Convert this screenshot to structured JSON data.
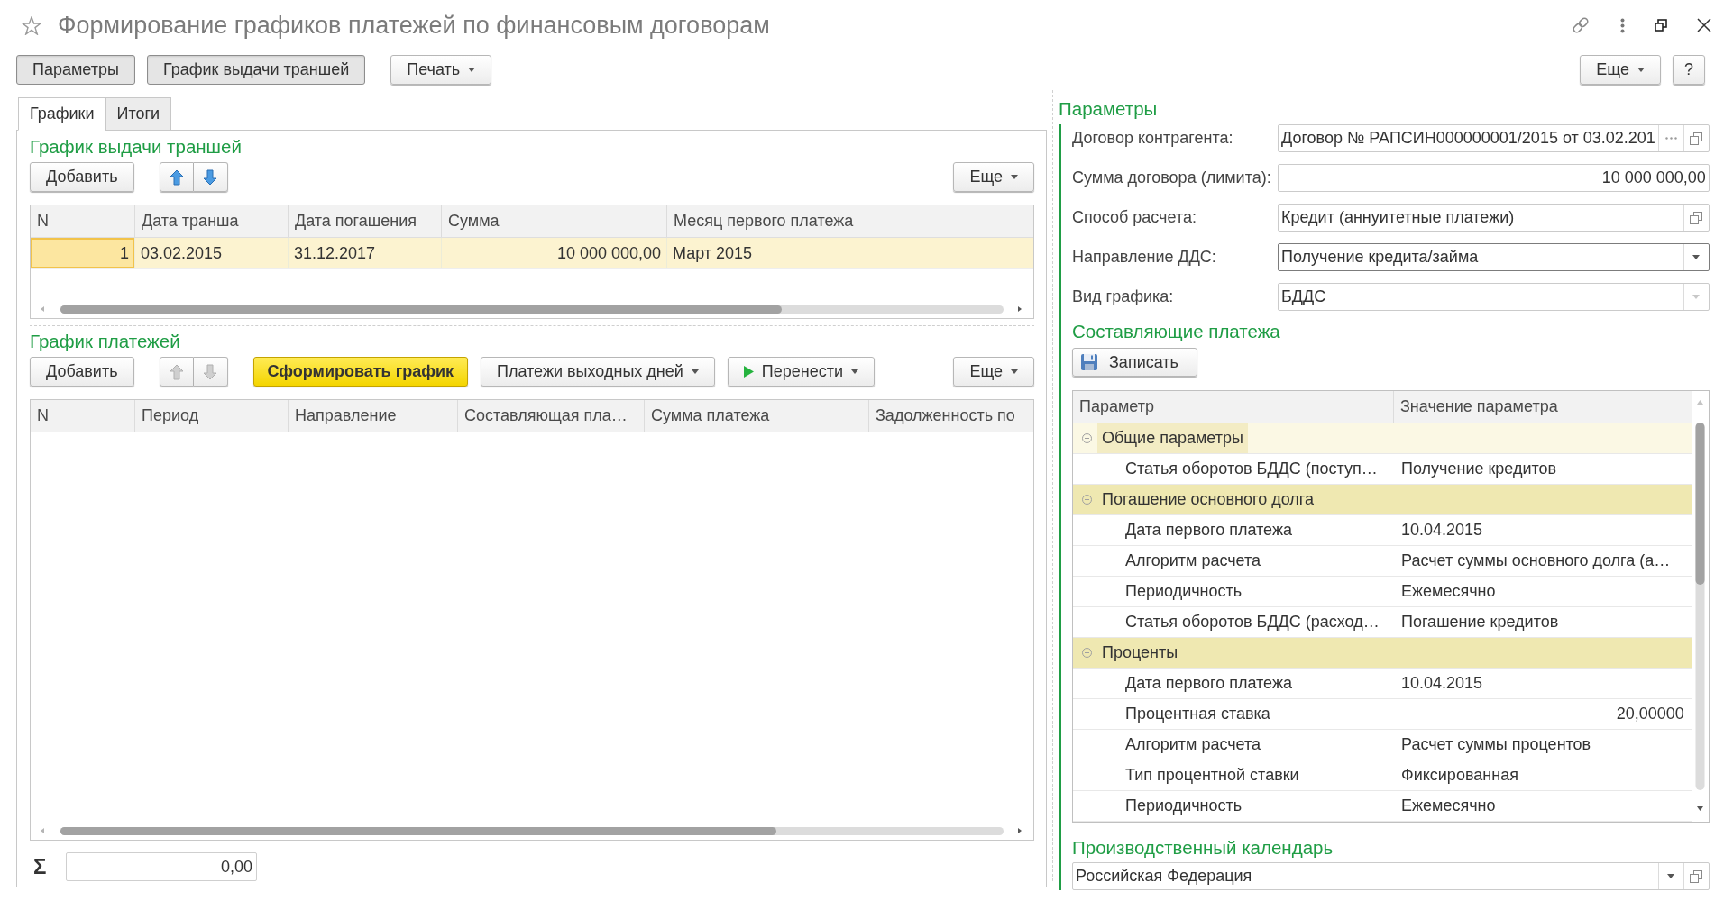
{
  "window": {
    "title": "Формирование графиков платежей по финансовым договорам"
  },
  "command_bar": {
    "buttons": [
      {
        "label": "Параметры",
        "pressed": true,
        "menu": false
      },
      {
        "label": "График выдачи траншей",
        "pressed": true,
        "menu": false
      },
      {
        "label": "Печать",
        "pressed": false,
        "menu": true
      }
    ],
    "more": "Еще",
    "help": "?"
  },
  "tabs": [
    {
      "label": "Графики",
      "selected": true
    },
    {
      "label": "Итоги",
      "selected": false
    }
  ],
  "tranches": {
    "title": "График выдачи траншей",
    "add": "Добавить",
    "move_enabled": true,
    "more": "Еще",
    "columns": [
      {
        "label": "N",
        "kind": "number"
      },
      {
        "label": "Дата транша",
        "kind": "text"
      },
      {
        "label": "Дата погашения",
        "kind": "text"
      },
      {
        "label": "Сумма",
        "kind": "number"
      },
      {
        "label": "Месяц первого платежа",
        "kind": "text"
      }
    ],
    "rows": [
      {
        "cells": [
          "1",
          "03.02.2015",
          "31.12.2017",
          "10 000 000,00",
          "Март 2015"
        ],
        "selected": true
      }
    ]
  },
  "payments": {
    "title": "График платежей",
    "add": "Добавить",
    "move_enabled": false,
    "buttons": [
      {
        "label": "Сформировать график",
        "kind": "primary"
      },
      {
        "label": "Платежи выходных дней",
        "kind": "menu"
      },
      {
        "label": "Перенести",
        "kind": "run"
      }
    ],
    "more": "Еще",
    "columns": [
      "N",
      "Период",
      "Направление",
      "Составляющая пла…",
      "Сумма платежа",
      "Задолженность по"
    ],
    "total_sign": "Σ",
    "total": "0,00"
  },
  "parameters": {
    "title": "Параметры",
    "fields": [
      {
        "label": "Договор контрагента:",
        "value": "Договор № РАПСИН000000001/2015 от 03.02.201",
        "kind": "text",
        "focused": false,
        "buttons": [
          {
            "kind": "choice",
            "disabled": false
          },
          {
            "kind": "open",
            "disabled": false
          }
        ]
      },
      {
        "label": "Сумма договора (лимита):",
        "value": "10 000 000,00",
        "kind": "number",
        "focused": false
      },
      {
        "label": "Способ расчета:",
        "value": "Кредит (аннуитетные платежи)",
        "kind": "text",
        "focused": false,
        "buttons": [
          {
            "kind": "open",
            "disabled": false
          }
        ]
      },
      {
        "label": "Направление ДДС:",
        "value": "Получение кредита/займа",
        "kind": "text",
        "focused": true,
        "buttons": [
          {
            "kind": "dropdown",
            "disabled": false
          }
        ]
      },
      {
        "label": "Вид графика:",
        "value": "БДДС",
        "kind": "text",
        "focused": false,
        "buttons": [
          {
            "kind": "dropdown",
            "disabled": true
          }
        ]
      }
    ]
  },
  "components": {
    "title": "Составляющие платежа",
    "save": "Записать",
    "columns": [
      "Параметр",
      "Значение параметра"
    ],
    "rows": [
      {
        "parameter": "Общие параметры",
        "expanded": true,
        "selected": true,
        "children": [
          {
            "parameter": "Статья оборотов БДДС (поступ…",
            "value": "Получение кредитов",
            "kind": "text",
            "selected": false
          }
        ]
      },
      {
        "parameter": "Погашение основного долга",
        "expanded": true,
        "selected": false,
        "children": [
          {
            "parameter": "Дата первого платежа",
            "value": "10.04.2015",
            "kind": "text",
            "selected": false
          },
          {
            "parameter": "Алгоритм расчета",
            "value": "Расчет суммы основного долга (а…",
            "kind": "text",
            "selected": false
          },
          {
            "parameter": "Периодичность",
            "value": "Ежемесячно",
            "kind": "text",
            "selected": false
          },
          {
            "parameter": "Статья оборотов БДДС (расход…",
            "value": "Погашение кредитов",
            "kind": "text",
            "selected": false
          }
        ]
      },
      {
        "parameter": "Проценты",
        "expanded": true,
        "selected": false,
        "children": [
          {
            "parameter": "Дата первого платежа",
            "value": "10.04.2015",
            "kind": "text",
            "selected": false
          },
          {
            "parameter": "Процентная ставка",
            "value": "20,00000",
            "kind": "number",
            "selected": false
          },
          {
            "parameter": "Алгоритм расчета",
            "value": "Расчет суммы процентов",
            "kind": "text",
            "selected": false
          },
          {
            "parameter": "Тип процентной ставки",
            "value": "Фиксированная",
            "kind": "text",
            "selected": false
          },
          {
            "parameter": "Периодичность",
            "value": "Ежемесячно",
            "kind": "text",
            "selected": false
          }
        ]
      }
    ]
  },
  "calendar": {
    "title": "Производственный календарь",
    "value": "Российская Федерация",
    "buttons": [
      {
        "kind": "dropdown",
        "disabled": false
      },
      {
        "kind": "open",
        "disabled": false
      }
    ]
  }
}
